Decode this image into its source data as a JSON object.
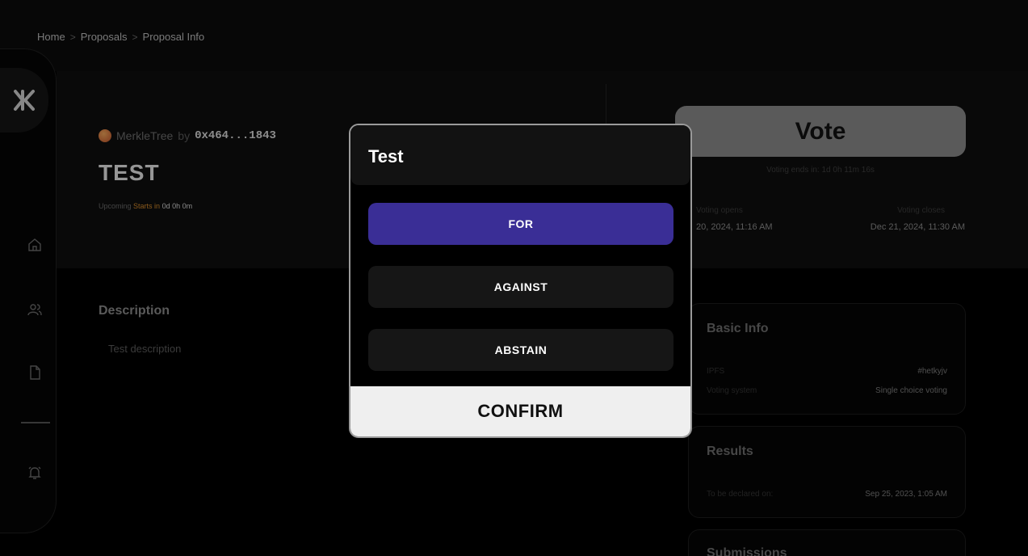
{
  "breadcrumb": {
    "home": "Home",
    "proposals": "Proposals",
    "current": "Proposal Info",
    "separator": ">"
  },
  "proposal": {
    "org": "MerkleTree",
    "by": "by",
    "author": "0x464...1843",
    "title": "TEST",
    "status": {
      "state": "Upcoming",
      "starts_label": "Starts in",
      "starts_value": "0d 0h 0m"
    }
  },
  "vote_panel": {
    "button_label": "Vote",
    "ends_text": "Voting ends in: 1d 0h 11m 16s",
    "opens_label": "Voting opens",
    "opens_value": "20, 2024, 11:16 AM",
    "closes_label": "Voting closes",
    "closes_value": "Dec 21, 2024, 11:30 AM"
  },
  "description": {
    "heading": "Description",
    "text": "Test description"
  },
  "basic_info": {
    "title": "Basic Info",
    "rows": [
      {
        "key": "IPFS",
        "value": "#hetkyjv"
      },
      {
        "key": "Voting system",
        "value": "Single choice voting"
      }
    ]
  },
  "results": {
    "title": "Results",
    "rows": [
      {
        "key": "To be declared on:",
        "value": "Sep 25, 2023, 1:05 AM"
      }
    ]
  },
  "submissions": {
    "title": "Submissions"
  },
  "modal": {
    "title": "Test",
    "options": [
      {
        "label": "FOR",
        "selected": true
      },
      {
        "label": "AGAINST",
        "selected": false
      },
      {
        "label": "ABSTAIN",
        "selected": false
      }
    ],
    "confirm_label": "CONFIRM"
  },
  "colors": {
    "accent": "#3a2e96",
    "background": "#000000",
    "starts_in": "#d4892b",
    "confirm_bg": "#efefef"
  },
  "icons": {
    "logo": "brand-logo-icon",
    "nav": [
      "home-icon",
      "users-icon",
      "document-icon",
      "bell-icon"
    ]
  }
}
